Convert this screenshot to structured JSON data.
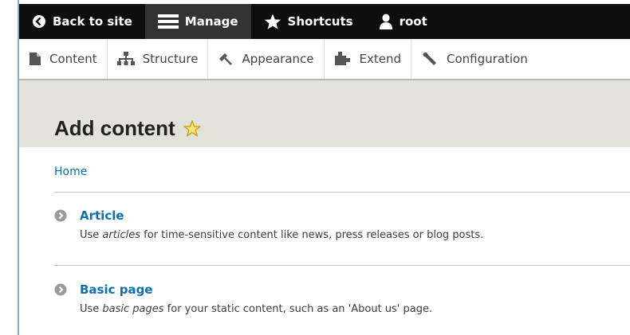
{
  "toolbar": {
    "back": "Back to site",
    "manage": "Manage",
    "shortcuts": "Shortcuts",
    "user": "root"
  },
  "tray": [
    {
      "label": "Content",
      "icon": "content-icon"
    },
    {
      "label": "Structure",
      "icon": "structure-icon"
    },
    {
      "label": "Appearance",
      "icon": "appearance-icon"
    },
    {
      "label": "Extend",
      "icon": "extend-icon"
    },
    {
      "label": "Configuration",
      "icon": "configuration-icon"
    }
  ],
  "page": {
    "title": "Add content",
    "breadcrumb": "Home"
  },
  "content_types": [
    {
      "label": "Article",
      "desc_prefix": "Use ",
      "desc_em": "articles",
      "desc_suffix": " for time-sensitive content like news, press releases or blog posts."
    },
    {
      "label": "Basic page",
      "desc_prefix": "Use ",
      "desc_em": "basic pages",
      "desc_suffix": " for your static content, such as an 'About us' page."
    }
  ],
  "colors": {
    "toolbar_bg": "#0e0e0e",
    "toolbar_active": "#333333",
    "title_band": "#e2e1da",
    "link": "#0d6fb2",
    "star": "#f4c91b"
  }
}
